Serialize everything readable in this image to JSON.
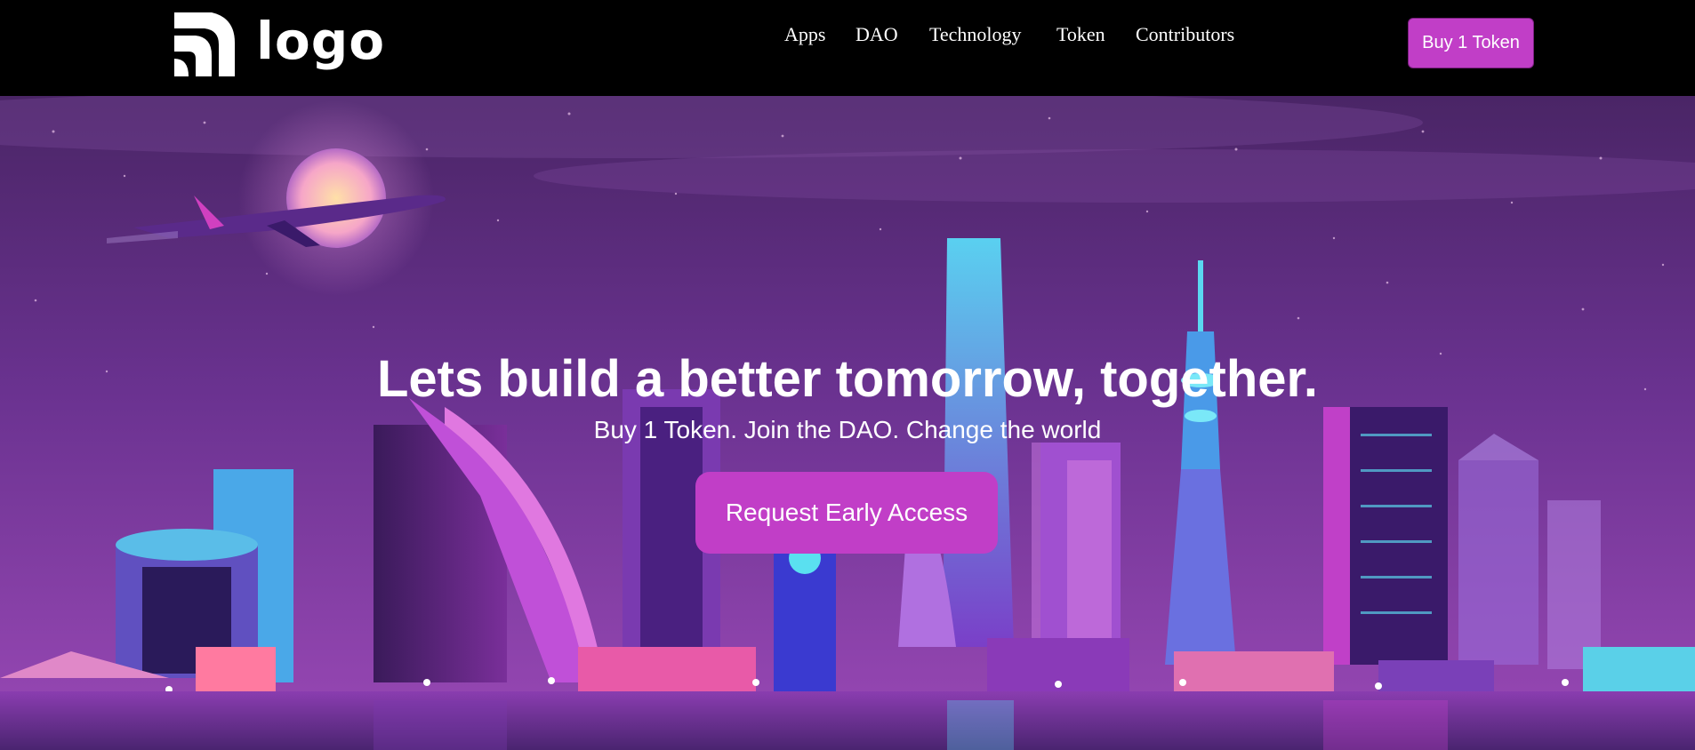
{
  "header": {
    "logo_text": "logo",
    "nav": [
      "Apps",
      "DAO",
      "Technology",
      "Token",
      "Contributors"
    ],
    "buy_button": "Buy 1 Token"
  },
  "hero": {
    "headline": "Lets build a better tomorrow, together.",
    "subheadline": "Buy 1 Token. Join the DAO. Change the world",
    "cta_button": "Request Early Access"
  },
  "colors": {
    "accent": "#c13ec7",
    "header_bg": "#000000",
    "sky_top": "#5a2a7a",
    "sky_bottom": "#8a3fa8"
  }
}
